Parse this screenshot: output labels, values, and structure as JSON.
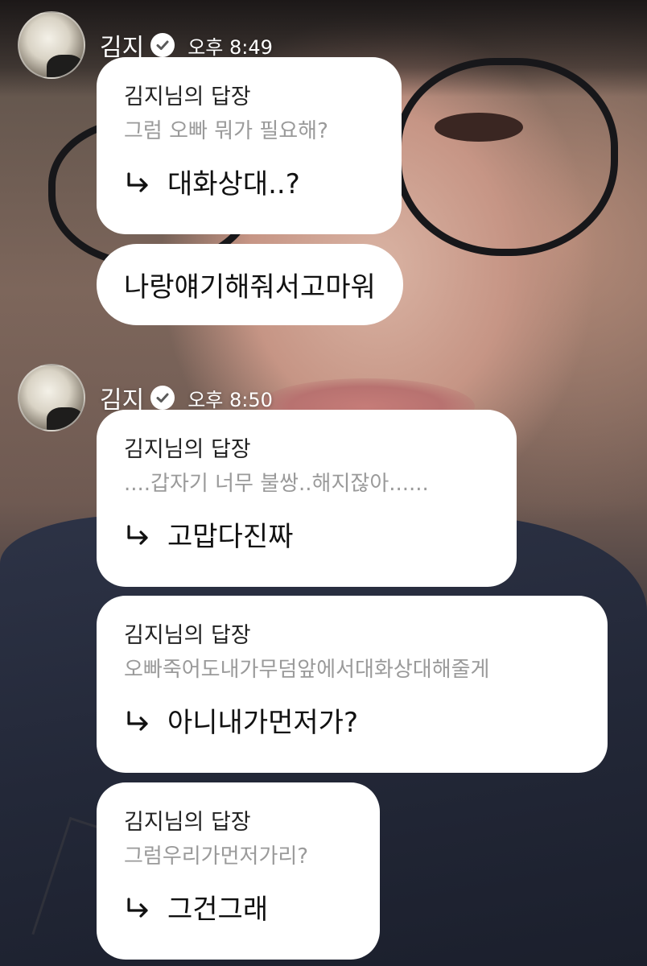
{
  "groups": [
    {
      "sender": "김지",
      "time": "오후 8:49",
      "messages": [
        {
          "type": "reply",
          "title": "김지님의 답장",
          "quote": "그럼 오빠 뭐가 필요해?",
          "answer": "대화상대..?"
        },
        {
          "type": "text",
          "text": "나랑얘기해줘서고마워"
        }
      ]
    },
    {
      "sender": "김지",
      "time": "오후 8:50",
      "messages": [
        {
          "type": "reply",
          "title": "김지님의 답장",
          "quote": "....갑자기 너무 불쌍..해지잖아......",
          "answer": "고맙다진짜"
        },
        {
          "type": "reply",
          "title": "김지님의 답장",
          "quote": "오빠죽어도내가무덤앞에서대화상대해줄게",
          "answer": "아니내가먼저가?"
        },
        {
          "type": "reply",
          "title": "김지님의 답장",
          "quote": "그럼우리가먼저가리?",
          "answer": "그건그래"
        }
      ]
    }
  ],
  "icons": {
    "verified": "verified-check-icon",
    "reply": "reply-arrow-icon"
  },
  "colors": {
    "bubble": "#ffffff",
    "quote_text": "#9a9a9a",
    "title_text": "#222222"
  }
}
